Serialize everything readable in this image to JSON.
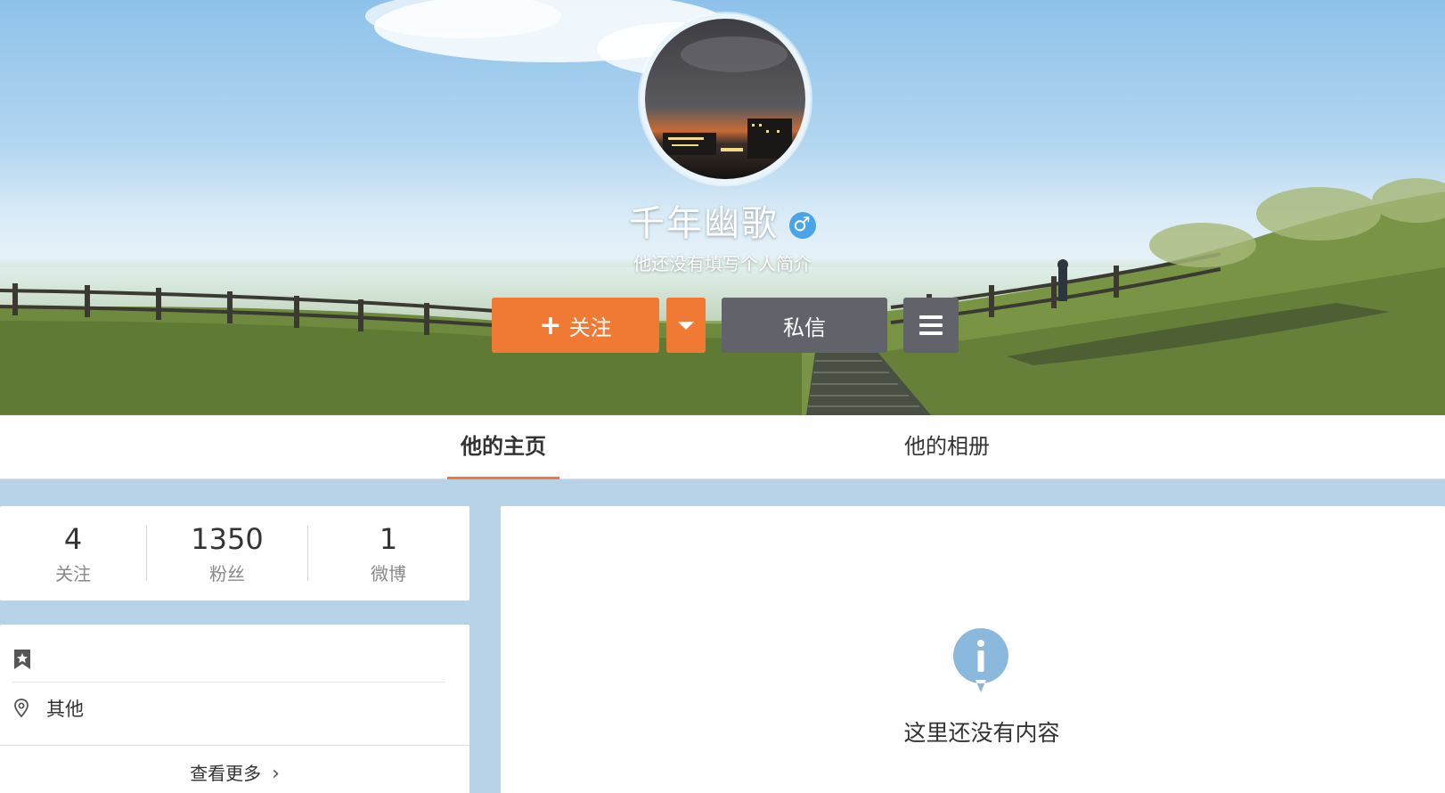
{
  "profile": {
    "name": "千年幽歌",
    "gender_icon": "male-icon",
    "bio": "他还没有填写个人简介"
  },
  "actions": {
    "follow_plus": "+",
    "follow_label": "关注",
    "message_label": "私信"
  },
  "tabs": [
    {
      "label": "他的主页",
      "active": true
    },
    {
      "label": "他的相册",
      "active": false
    }
  ],
  "stats": [
    {
      "value": "4",
      "label": "关注"
    },
    {
      "value": "1350",
      "label": "粉丝"
    },
    {
      "value": "1",
      "label": "微博"
    }
  ],
  "info": {
    "location": "其他",
    "more_label": "查看更多",
    "more_chevron": "›"
  },
  "main": {
    "empty_text": "这里还没有内容"
  },
  "colors": {
    "accent": "#f07a34",
    "button_dark": "#61626a",
    "page_bg": "#b8d3e8",
    "info_icon": "#8ab9dd"
  }
}
